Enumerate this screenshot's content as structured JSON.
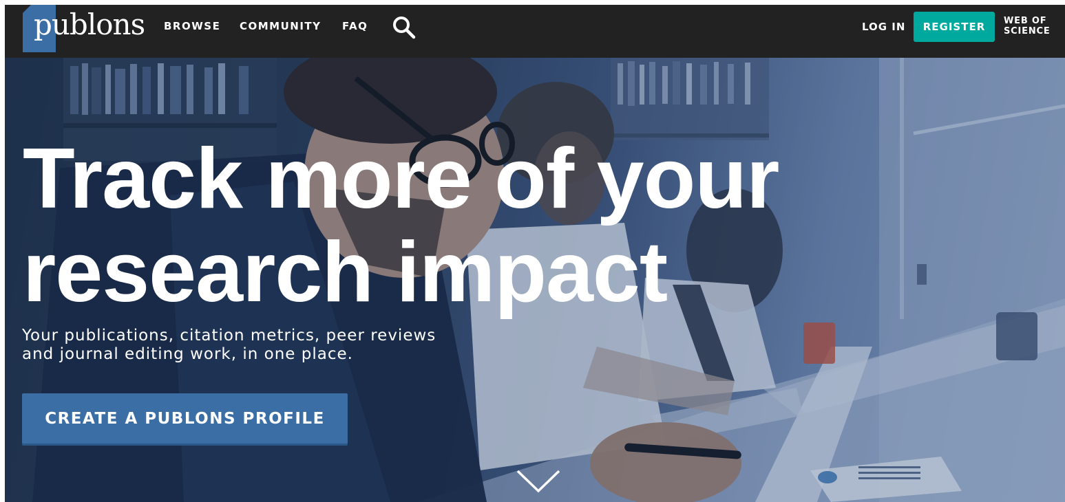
{
  "brand": {
    "logo_text": "publons",
    "logo_color": "#3b6ea5"
  },
  "nav": {
    "browse": "BROWSE",
    "community": "COMMUNITY",
    "faq": "FAQ",
    "search_icon": "search-icon",
    "login": "LOG IN",
    "register": "REGISTER",
    "register_color": "#00a99d",
    "wos_line1": "WEB OF",
    "wos_line2": "SCIENCE"
  },
  "hero": {
    "title_line1": "Track more of your",
    "title_line2": "research impact",
    "subtitle_line1": "Your publications, citation metrics, peer reviews",
    "subtitle_line2": "and journal editing work, in one place.",
    "cta_label": "CREATE A PUBLONS PROFILE",
    "scroll_icon": "chevron-down-icon"
  }
}
